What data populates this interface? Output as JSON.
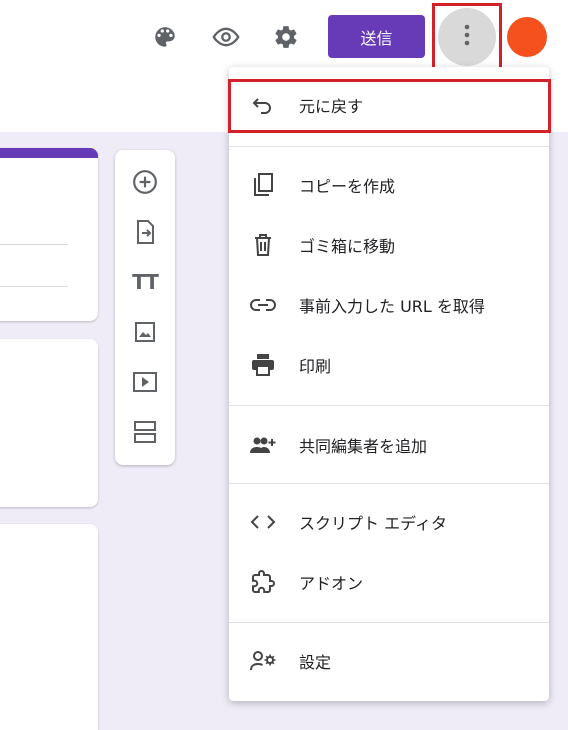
{
  "header": {
    "send_label": "送信",
    "icons": [
      "palette-icon",
      "eye-icon",
      "gear-icon",
      "more-vert-icon"
    ],
    "avatar_color": "#f4511e",
    "accent_color": "#673ab7"
  },
  "toolbar": {
    "tools": [
      "add-circle-icon",
      "import-icon",
      "title-icon",
      "image-icon",
      "video-icon",
      "section-icon"
    ],
    "title_glyph": "TT"
  },
  "menu": {
    "items": [
      {
        "label": "元に戻す",
        "icon": "undo-icon"
      },
      {
        "label": "コピーを作成",
        "icon": "copy-icon"
      },
      {
        "label": "ゴミ箱に移動",
        "icon": "trash-icon"
      },
      {
        "label": "事前入力した URL を取得",
        "icon": "link-icon"
      },
      {
        "label": "印刷",
        "icon": "print-icon"
      },
      {
        "label": "共同編集者を追加",
        "icon": "add-people-icon"
      },
      {
        "label": "スクリプト エディタ",
        "icon": "code-icon"
      },
      {
        "label": "アドオン",
        "icon": "puzzle-icon"
      },
      {
        "label": "設定",
        "icon": "person-settings-icon"
      }
    ]
  },
  "highlight_color": "#d3202a"
}
